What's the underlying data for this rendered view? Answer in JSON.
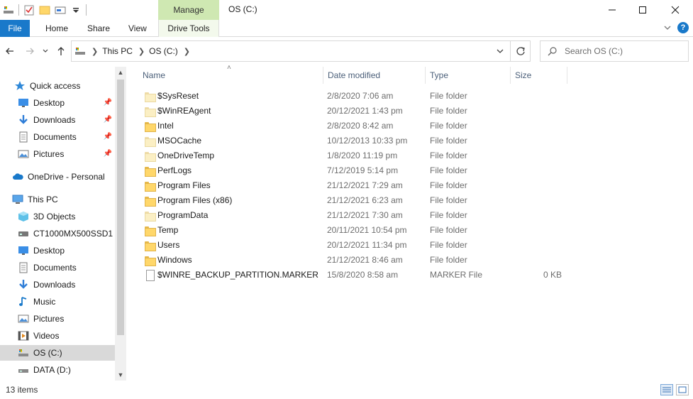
{
  "window": {
    "title": "OS (C:)",
    "context_tab": "Manage"
  },
  "ribbon": {
    "tabs": [
      {
        "label": "File"
      },
      {
        "label": "Home"
      },
      {
        "label": "Share"
      },
      {
        "label": "View"
      },
      {
        "label": "Drive Tools"
      }
    ]
  },
  "address": {
    "crumbs": [
      "This PC",
      "OS (C:)"
    ],
    "search_placeholder": "Search OS (C:)"
  },
  "nav": {
    "items": [
      {
        "label": "Quick access",
        "icon": "star-icon",
        "pinned": false
      },
      {
        "label": "Desktop",
        "icon": "desktop-icon",
        "pinned": true
      },
      {
        "label": "Downloads",
        "icon": "download-icon",
        "pinned": true
      },
      {
        "label": "Documents",
        "icon": "documents-icon",
        "pinned": true
      },
      {
        "label": "Pictures",
        "icon": "pictures-icon",
        "pinned": true
      },
      {
        "label": "OneDrive - Personal",
        "icon": "cloud-icon",
        "pinned": false
      },
      {
        "label": "This PC",
        "icon": "computer-icon",
        "pinned": false
      },
      {
        "label": "3D Objects",
        "icon": "cube-icon",
        "pinned": false
      },
      {
        "label": "CT1000MX500SSD1",
        "icon": "drive-icon",
        "pinned": false
      },
      {
        "label": "Desktop",
        "icon": "desktop-icon",
        "pinned": false
      },
      {
        "label": "Documents",
        "icon": "documents-icon",
        "pinned": false
      },
      {
        "label": "Downloads",
        "icon": "download-icon",
        "pinned": false
      },
      {
        "label": "Music",
        "icon": "music-icon",
        "pinned": false
      },
      {
        "label": "Pictures",
        "icon": "pictures-icon",
        "pinned": false
      },
      {
        "label": "Videos",
        "icon": "videos-icon",
        "pinned": false
      },
      {
        "label": "OS (C:)",
        "icon": "windows-drive-icon",
        "pinned": false,
        "selected": true
      },
      {
        "label": "DATA (D:)",
        "icon": "drive-icon",
        "pinned": false
      }
    ]
  },
  "columns": {
    "name": "Name",
    "date": "Date modified",
    "type": "Type",
    "size": "Size"
  },
  "files": [
    {
      "name": "$SysReset",
      "date": "2/8/2020 7:06 am",
      "type": "File folder",
      "size": "",
      "icon": "folder-icon",
      "hidden": true
    },
    {
      "name": "$WinREAgent",
      "date": "20/12/2021 1:43 pm",
      "type": "File folder",
      "size": "",
      "icon": "folder-icon",
      "hidden": true
    },
    {
      "name": "Intel",
      "date": "2/8/2020 8:42 am",
      "type": "File folder",
      "size": "",
      "icon": "folder-icon",
      "hidden": false
    },
    {
      "name": "MSOCache",
      "date": "10/12/2013 10:33 pm",
      "type": "File folder",
      "size": "",
      "icon": "folder-icon",
      "hidden": true
    },
    {
      "name": "OneDriveTemp",
      "date": "1/8/2020 11:19 pm",
      "type": "File folder",
      "size": "",
      "icon": "folder-icon",
      "hidden": true
    },
    {
      "name": "PerfLogs",
      "date": "7/12/2019 5:14 pm",
      "type": "File folder",
      "size": "",
      "icon": "folder-icon",
      "hidden": false
    },
    {
      "name": "Program Files",
      "date": "21/12/2021 7:29 am",
      "type": "File folder",
      "size": "",
      "icon": "folder-icon",
      "hidden": false
    },
    {
      "name": "Program Files (x86)",
      "date": "21/12/2021 6:23 am",
      "type": "File folder",
      "size": "",
      "icon": "folder-icon",
      "hidden": false
    },
    {
      "name": "ProgramData",
      "date": "21/12/2021 7:30 am",
      "type": "File folder",
      "size": "",
      "icon": "folder-icon",
      "hidden": true
    },
    {
      "name": "Temp",
      "date": "20/11/2021 10:54 pm",
      "type": "File folder",
      "size": "",
      "icon": "folder-icon",
      "hidden": false
    },
    {
      "name": "Users",
      "date": "20/12/2021 11:34 pm",
      "type": "File folder",
      "size": "",
      "icon": "folder-icon",
      "hidden": false
    },
    {
      "name": "Windows",
      "date": "21/12/2021 8:46 am",
      "type": "File folder",
      "size": "",
      "icon": "folder-icon",
      "hidden": false
    },
    {
      "name": "$WINRE_BACKUP_PARTITION.MARKER",
      "date": "15/8/2020 8:58 am",
      "type": "MARKER File",
      "size": "0 KB",
      "icon": "file-icon",
      "hidden": false
    }
  ],
  "status": {
    "count": "13 items"
  },
  "colors": {
    "accent": "#1979ca",
    "manage_tab": "#cfe8b2",
    "selected_nav": "#d9d9d9"
  }
}
